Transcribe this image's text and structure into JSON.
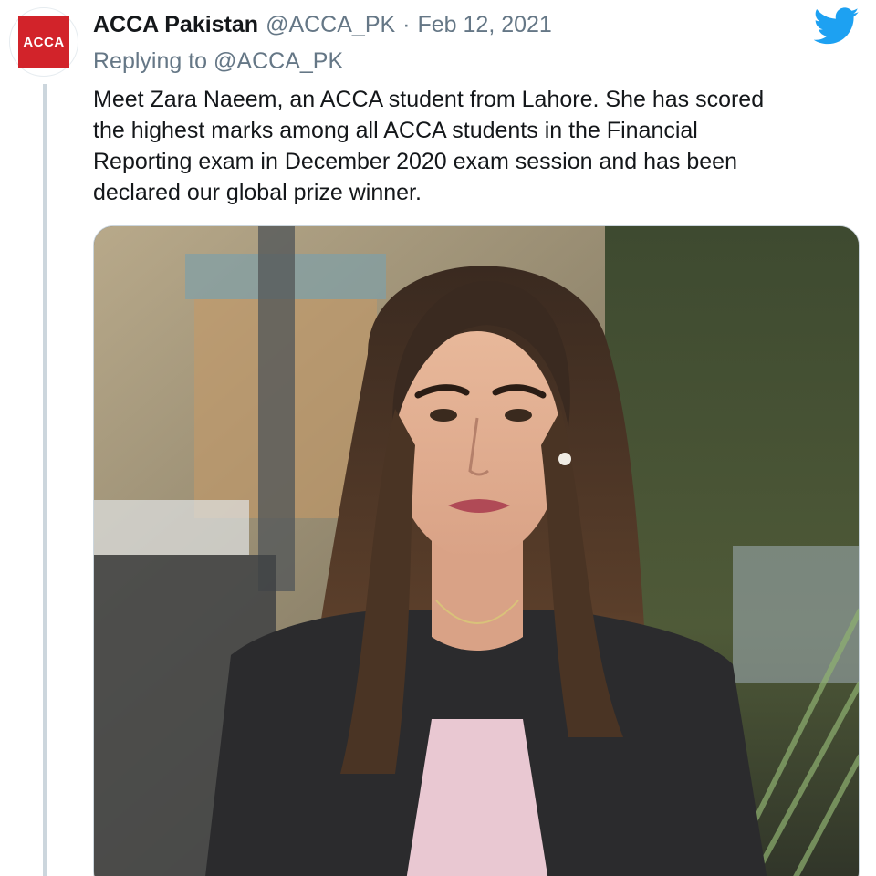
{
  "tweet": {
    "avatar_label": "ACCA",
    "display_name": "ACCA Pakistan",
    "handle": "@ACCA_PK",
    "separator": "·",
    "date": "Feb 12, 2021",
    "replying_prefix": "Replying to",
    "replying_to": "@ACCA_PK",
    "text_lines": [
      "Meet Zara Naeem, an ACCA student from Lahore. She has scored",
      "the highest marks among all ACCA students in the Financial",
      "Reporting exam in December 2020 exam session and has been",
      "declared our global prize winner."
    ],
    "media": {
      "description": "photo"
    }
  },
  "colors": {
    "brand_red": "#d2232a",
    "twitter_blue": "#1da1f2",
    "text_primary": "#14171a",
    "text_secondary": "#657786",
    "thread_line": "#ccd6dd"
  },
  "icons": {
    "platform": "twitter-bird-icon"
  }
}
